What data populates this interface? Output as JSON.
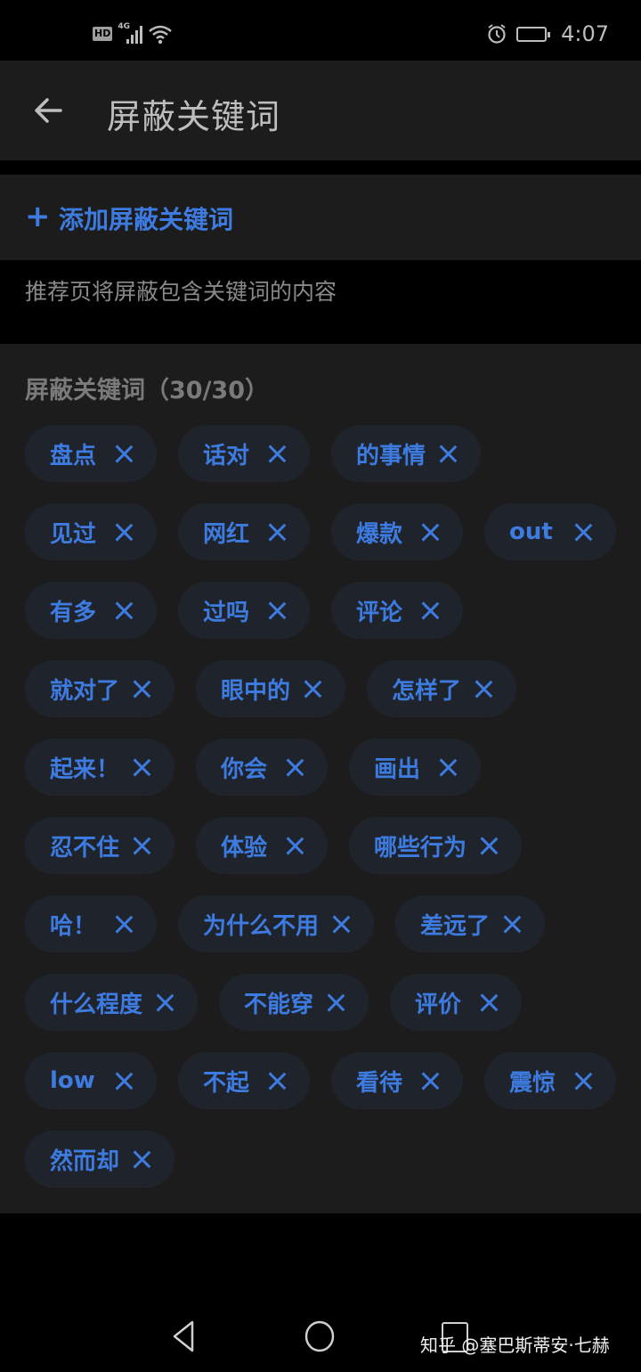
{
  "status_bar": {
    "left_badge": "HD",
    "network": "4G",
    "time": "4:07"
  },
  "app_bar": {
    "back_icon": "arrow-left-icon",
    "title": "屏蔽关键词"
  },
  "add_keyword": {
    "icon": "plus-icon",
    "label": "添加屏蔽关键词"
  },
  "hint": "推荐页将屏蔽包含关键词的内容",
  "keywords_section": {
    "title": "屏蔽关键词（30/30）",
    "count": 30,
    "limit": 30,
    "rows": [
      [
        "盘点",
        "话对",
        "的事情"
      ],
      [
        "见过",
        "网红",
        "爆款",
        "out"
      ],
      [
        "有多",
        "过吗",
        "评论"
      ],
      [
        "就对了",
        "眼中的",
        "怎样了"
      ],
      [
        "起来！",
        "你会",
        "画出"
      ],
      [
        "忍不住",
        "体验",
        "哪些行为"
      ],
      [
        "哈！",
        "为什么不用",
        "差远了"
      ],
      [
        "什么程度",
        "不能穿",
        "评价"
      ],
      [
        "low",
        "不起",
        "看待",
        "震惊"
      ],
      [
        "然而却"
      ]
    ]
  },
  "nav_bar": {
    "back": "nav-back-icon",
    "home": "nav-home-icon",
    "recent": "nav-recent-icon"
  },
  "watermark": "知乎 @塞巴斯蒂安·七赫",
  "colors": {
    "accent": "#3d7be0",
    "surface": "#1c1c1c",
    "chip_bg": "#1f232b",
    "background": "#000000"
  }
}
